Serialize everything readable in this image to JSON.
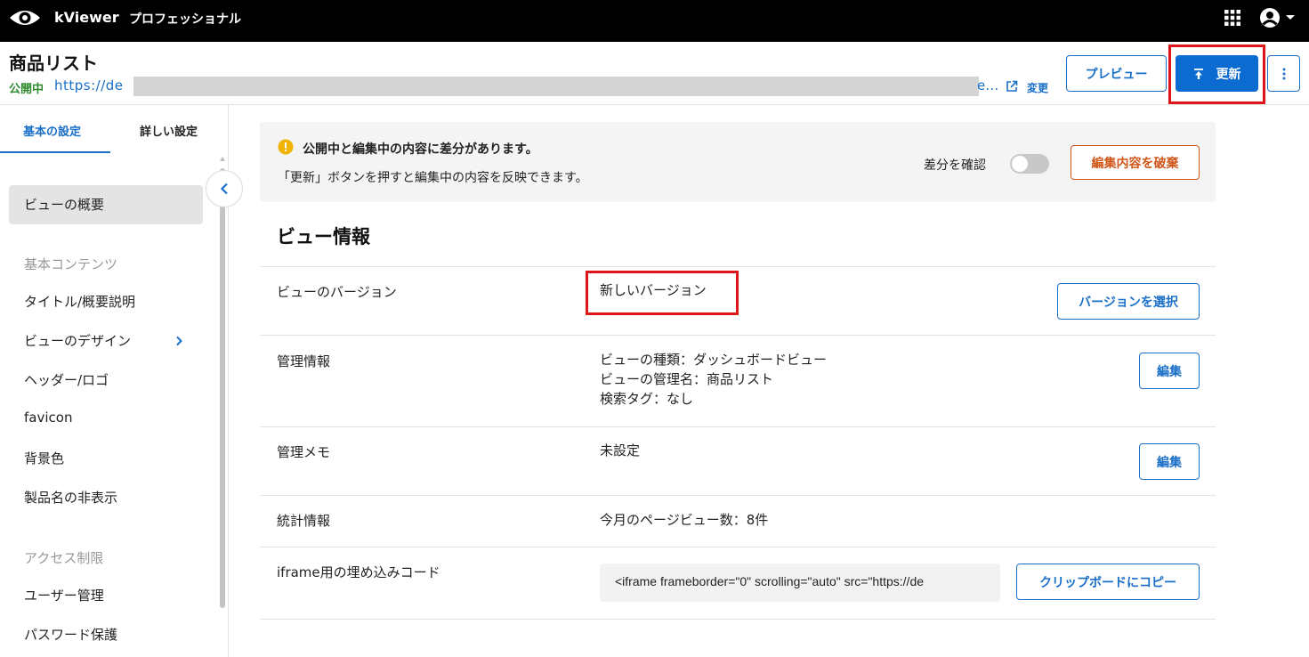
{
  "app": {
    "name": "kViewer",
    "edition": "プロフェッショナル"
  },
  "header": {
    "title": "商品リスト",
    "status": "公開中",
    "url_start": "https://de",
    "url_end": "e…",
    "change_label": "変更",
    "preview_label": "プレビュー",
    "update_label": "更新"
  },
  "sidebar": {
    "tabs": [
      "基本の設定",
      "詳しい設定"
    ],
    "active_item": "ビューの概要",
    "group_basic": "基本コンテンツ",
    "basic_items": [
      "タイトル/概要説明",
      "ビューのデザイン",
      "ヘッダー/ロゴ",
      "favicon",
      "背景色",
      "製品名の非表示"
    ],
    "group_access": "アクセス制限",
    "access_items": [
      "ユーザー管理",
      "パスワード保護"
    ]
  },
  "notice": {
    "title": "公開中と編集中の内容に差分があります。",
    "body": "「更新」ボタンを押すと編集中の内容を反映できます。",
    "diff_label": "差分を確認",
    "discard_label": "編集内容を破棄"
  },
  "section": {
    "title": "ビュー情報",
    "rows": [
      {
        "label": "ビューのバージョン",
        "value": "新しいバージョン",
        "button": "バージョンを選択"
      },
      {
        "label": "管理情報",
        "lines": [
          "ビューの種類：ダッシュボードビュー",
          "ビューの管理名：商品リスト",
          "検索タグ：なし"
        ],
        "button": "編集"
      },
      {
        "label": "管理メモ",
        "value": "未設定",
        "button": "編集"
      },
      {
        "label": "統計情報",
        "value": "今月のページビュー数：8件"
      },
      {
        "label": "iframe用の埋め込みコード",
        "code": "<iframe frameborder=\"0\" scrolling=\"auto\" src=\"https://de",
        "button": "クリップボードにコピー"
      }
    ]
  },
  "colors": {
    "topbar": "#000000",
    "primary": "#0b6bd0",
    "link": "#1a6fc9",
    "published": "#2e8b2e",
    "danger": "#d0561a",
    "highlight": "#e0151b"
  }
}
